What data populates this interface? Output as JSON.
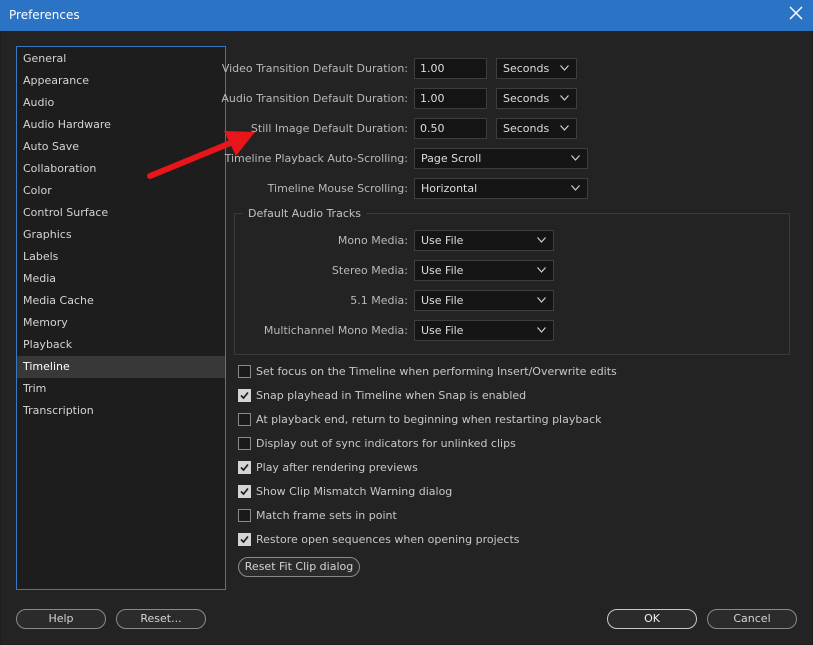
{
  "window": {
    "title": "Preferences"
  },
  "categories": [
    {
      "label": "General"
    },
    {
      "label": "Appearance"
    },
    {
      "label": "Audio"
    },
    {
      "label": "Audio Hardware"
    },
    {
      "label": "Auto Save"
    },
    {
      "label": "Collaboration"
    },
    {
      "label": "Color"
    },
    {
      "label": "Control Surface"
    },
    {
      "label": "Graphics"
    },
    {
      "label": "Labels"
    },
    {
      "label": "Media"
    },
    {
      "label": "Media Cache"
    },
    {
      "label": "Memory"
    },
    {
      "label": "Playback"
    },
    {
      "label": "Timeline",
      "selected": true
    },
    {
      "label": "Trim"
    },
    {
      "label": "Transcription"
    }
  ],
  "durations": {
    "video": {
      "label": "Video Transition Default Duration:",
      "value": "1.00",
      "unit": "Seconds"
    },
    "audio": {
      "label": "Audio Transition Default Duration:",
      "value": "1.00",
      "unit": "Seconds"
    },
    "still": {
      "label": "Still Image Default Duration:",
      "value": "0.50",
      "unit": "Seconds"
    }
  },
  "scrolling": {
    "playback": {
      "label": "Timeline Playback Auto-Scrolling:",
      "value": "Page Scroll"
    },
    "mouse": {
      "label": "Timeline Mouse Scrolling:",
      "value": "Horizontal"
    }
  },
  "audio_tracks": {
    "legend": "Default Audio Tracks",
    "mono": {
      "label": "Mono Media:",
      "value": "Use File"
    },
    "stereo": {
      "label": "Stereo Media:",
      "value": "Use File"
    },
    "surround": {
      "label": "5.1 Media:",
      "value": "Use File"
    },
    "multichannel": {
      "label": "Multichannel Mono Media:",
      "value": "Use File"
    }
  },
  "options": [
    {
      "label": "Set focus on the Timeline when performing Insert/Overwrite edits",
      "checked": false
    },
    {
      "label": "Snap playhead in Timeline when Snap is enabled",
      "checked": true
    },
    {
      "label": "At playback end, return to beginning when restarting playback",
      "checked": false
    },
    {
      "label": "Display out of sync indicators for unlinked clips",
      "checked": false
    },
    {
      "label": "Play after rendering previews",
      "checked": true
    },
    {
      "label": "Show Clip Mismatch Warning dialog",
      "checked": true
    },
    {
      "label": "Match frame sets in point",
      "checked": false
    },
    {
      "label": "Restore open sequences when opening projects",
      "checked": true
    }
  ],
  "buttons": {
    "reset_fit_clip": "Reset Fit Clip dialog",
    "help": "Help",
    "reset": "Reset...",
    "ok": "OK",
    "cancel": "Cancel"
  },
  "colors": {
    "titlebar": "#2a73c5",
    "panel_border": "#3a78c1",
    "annotation_arrow": "#e8151b"
  },
  "icons": {
    "close": "close-icon",
    "dropdown": "chevron-down-icon",
    "check": "checkmark-icon",
    "annotation": "red-arrow-annotation"
  }
}
